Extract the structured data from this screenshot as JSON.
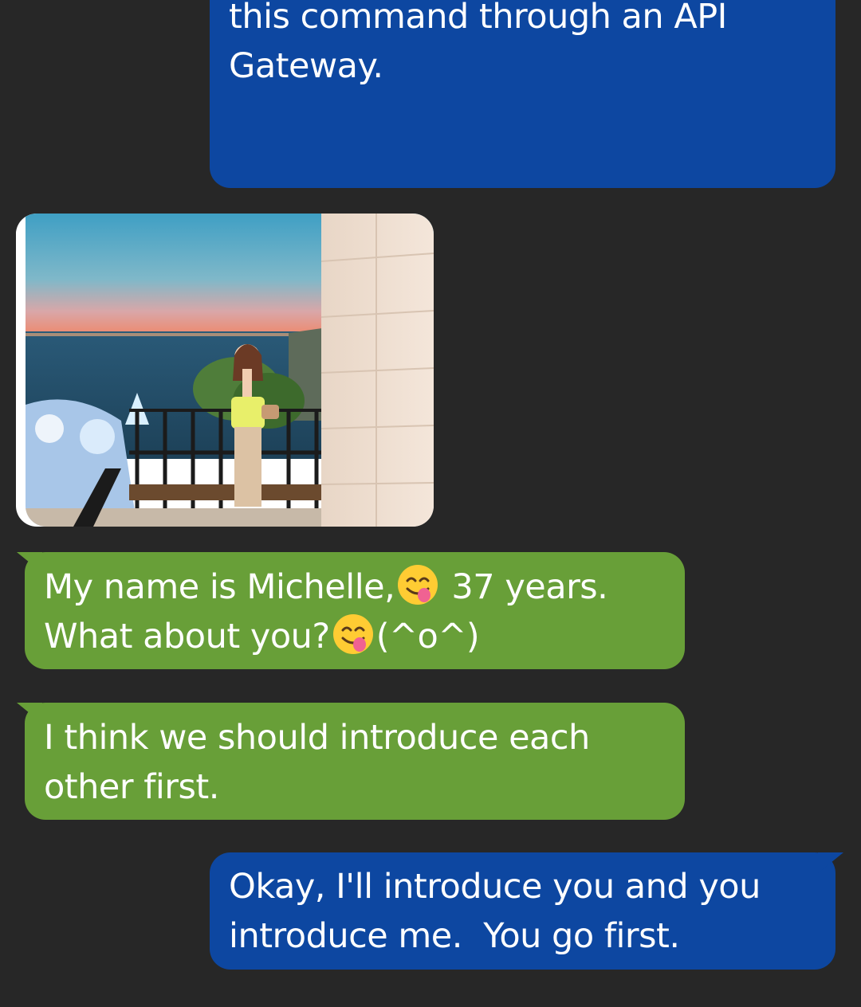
{
  "messages": [
    {
      "id": "msg-1",
      "direction": "outgoing",
      "lines": [
        "this command through an API",
        "Gateway."
      ]
    },
    {
      "id": "msg-photo",
      "direction": "incoming",
      "type": "image",
      "image": "photo of woman standing on balcony by the sea at sunset"
    },
    {
      "id": "msg-2",
      "direction": "incoming",
      "parts": {
        "p1": "My name is Michelle,",
        "emoji1": "face-savoring-food-emoji",
        "p2": " 37 years.",
        "p3": "What about you?",
        "emoji2": "face-savoring-food-emoji",
        "p4": "(^o^)"
      }
    },
    {
      "id": "msg-3",
      "direction": "incoming",
      "lines": [
        "I think we should introduce each",
        "other first."
      ]
    },
    {
      "id": "msg-4",
      "direction": "outgoing",
      "lines": [
        "Okay, I'll introduce you and you",
        "introduce me.  You go first."
      ]
    }
  ],
  "colors": {
    "background": "#272727",
    "outgoing_bubble": "#0d47a1",
    "incoming_bubble": "#689f38",
    "text": "#ffffff"
  }
}
